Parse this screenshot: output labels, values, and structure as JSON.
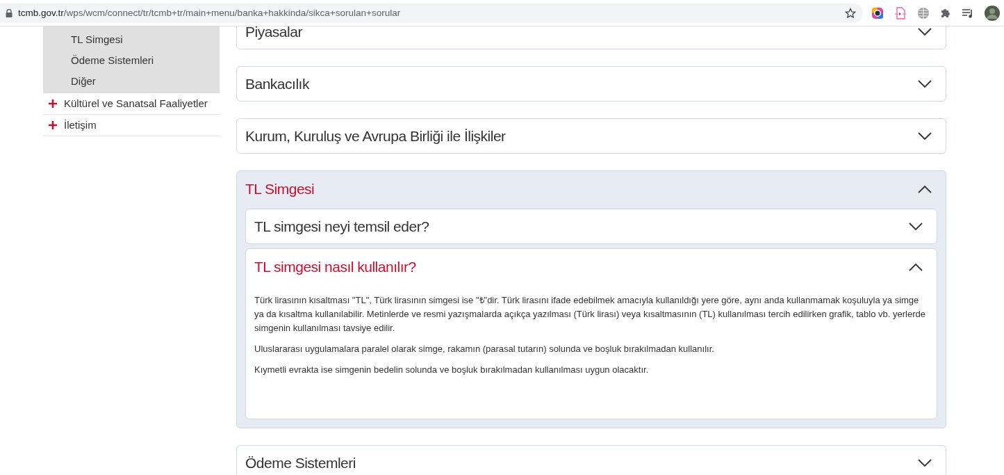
{
  "browser": {
    "url_host": "tcmb.gov.tr",
    "url_path": "/wps/wcm/connect/tr/tcmb+tr/main+menu/banka+hakkinda/sikca+sorulan+sorular"
  },
  "sidebar": {
    "subitems": [
      "TL Simgesi",
      "Ödeme Sistemleri",
      "Diğer"
    ],
    "items": [
      {
        "label": "Kültürel ve Sanatsal Faaliyetler",
        "expanded": false
      },
      {
        "label": "İletişim",
        "expanded": false
      }
    ]
  },
  "sections": [
    {
      "title": "Piyasalar",
      "expanded": false
    },
    {
      "title": "Bankacılık",
      "expanded": false
    },
    {
      "title": "Kurum, Kuruluş ve Avrupa Birliği ile İlişkiler",
      "expanded": false
    },
    {
      "title": "TL Simgesi",
      "expanded": true,
      "questions": [
        {
          "title": "TL simgesi neyi temsil eder?",
          "expanded": false
        },
        {
          "title": "TL simgesi nasıl kullanılır?",
          "expanded": true,
          "paragraphs": [
            "Türk lirasının kısaltması \"TL\", Türk lirasının simgesi ise \"₺\"dir. Türk lirasını ifade edebilmek amacıyla kullanıldığı yere göre, aynı anda kullanmamak koşuluyla ya simge ya da kısaltma kullanılabilir. Metinlerde ve resmi yazışmalarda açıkça yazılması (Türk lirası) veya kısaltmasının (TL) kullanılması tercih edilirken grafik, tablo vb. yerlerde simgenin kullanılması tavsiye edilir.",
            "Uluslararası uygulamalara paralel olarak simge, rakamın (parasal tutarın) solunda ve boşluk bırakılmadan kullanılır.",
            "Kıymetli evrakta ise simgenin bedelin solunda ve boşluk bırakılmadan kullanılması uygun olacaktır."
          ]
        }
      ]
    },
    {
      "title": "Ödeme Sistemleri",
      "expanded": false
    }
  ]
}
